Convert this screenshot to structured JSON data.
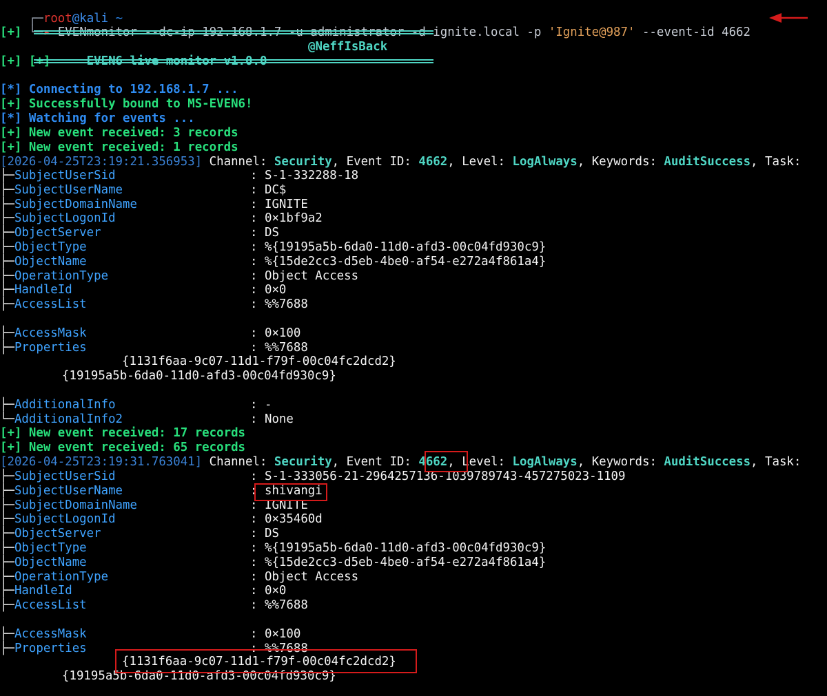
{
  "prompt": {
    "corner": "┌─",
    "user": "root",
    "at": "@",
    "host": "kali",
    "path": "~",
    "arrow": "└─",
    "caret": "▸",
    "cmd_name": "EVENmonitor",
    "cmd_args1": "--dc-ip 192.168.1.7 -u administrator -d ignite.local -p",
    "cmd_password": "'Ignite@987'",
    "cmd_args2": "--event-id 4662"
  },
  "banner": {
    "prefix": "[+]",
    "title": "EVEN6 live monitor v1.0.0",
    "author": "@NeffIsBack"
  },
  "status": [
    {
      "prefix": "[*]",
      "text": "Connecting to 192.168.1.7 ...",
      "kind": "info"
    },
    {
      "prefix": "[+]",
      "text": "Successfully bound to MS-EVEN6!",
      "kind": "ok"
    },
    {
      "prefix": "[*]",
      "text": "Watching for events ...",
      "kind": "info"
    },
    {
      "prefix": "[+]",
      "text": "New event received: 3 records",
      "kind": "ok"
    },
    {
      "prefix": "[+]",
      "text": "New event received: 1 records",
      "kind": "ok"
    }
  ],
  "labels": {
    "channel": "Channel:",
    "event_id": "Event ID:",
    "level": "Level:",
    "keywords": "Keywords:",
    "task": "Task:",
    "sep": ":"
  },
  "event1": {
    "timestamp": "[2026-04-25T23:19:21.356953]",
    "channel": "Security",
    "event_id": "4662",
    "level": "LogAlways",
    "keywords": "AuditSuccess",
    "fields": [
      {
        "key": "SubjectUserSid",
        "value": "S-1-332288-18"
      },
      {
        "key": "SubjectUserName",
        "value": "DC$"
      },
      {
        "key": "SubjectDomainName",
        "value": "IGNITE"
      },
      {
        "key": "SubjectLogonId",
        "value": "0×1bf9a2"
      },
      {
        "key": "ObjectServer",
        "value": "DS"
      },
      {
        "key": "ObjectType",
        "value": "%{19195a5b-6da0-11d0-afd3-00c04fd930c9}"
      },
      {
        "key": "ObjectName",
        "value": "%{15de2cc3-d5eb-4be0-af54-e272a4f861a4}"
      },
      {
        "key": "OperationType",
        "value": "Object Access"
      },
      {
        "key": "HandleId",
        "value": "0×0"
      },
      {
        "key": "AccessList",
        "value": "%%7688"
      },
      {
        "key": "AccessMask",
        "value": "0×100"
      },
      {
        "key": "Properties",
        "value": "%%7688"
      }
    ],
    "prop_line1": "{1131f6aa-9c07-11d1-f79f-00c04fc2dcd2}",
    "prop_line2": "{19195a5b-6da0-11d0-afd3-00c04fd930c9}",
    "additional": [
      {
        "key": "AdditionalInfo",
        "value": "-"
      },
      {
        "key": "AdditionalInfo2",
        "value": "None"
      }
    ]
  },
  "status2": [
    {
      "prefix": "[+]",
      "text": "New event received: 17 records"
    },
    {
      "prefix": "[+]",
      "text": "New event received: 65 records"
    }
  ],
  "event2": {
    "timestamp": "[2026-04-25T23:19:31.763041]",
    "channel": "Security",
    "event_id": "4662",
    "level": "LogAlways",
    "keywords": "AuditSuccess",
    "fields": [
      {
        "key": "SubjectUserSid",
        "value": "S-1-333056-21-2964257136-1039789743-457275023-1109"
      },
      {
        "key": "SubjectUserName",
        "value": "shivangi"
      },
      {
        "key": "SubjectDomainName",
        "value": "IGNITE"
      },
      {
        "key": "SubjectLogonId",
        "value": "0×35460d"
      },
      {
        "key": "ObjectServer",
        "value": "DS"
      },
      {
        "key": "ObjectType",
        "value": "%{19195a5b-6da0-11d0-afd3-00c04fd930c9}"
      },
      {
        "key": "ObjectName",
        "value": "%{15de2cc3-d5eb-4be0-af54-e272a4f861a4}"
      },
      {
        "key": "OperationType",
        "value": "Object Access"
      },
      {
        "key": "HandleId",
        "value": "0×0"
      },
      {
        "key": "AccessList",
        "value": "%%7688"
      },
      {
        "key": "AccessMask",
        "value": "0×100"
      },
      {
        "key": "Properties",
        "value": "%%7688"
      }
    ],
    "prop_line1": "{1131f6aa-9c07-11d1-f79f-00c04fc2dcd2}",
    "prop_line2": "{19195a5b-6da0-11d0-afd3-00c04fd930c9}"
  },
  "colors": {
    "background": "#000000",
    "annotation_red": "#d51b1b",
    "accent_teal": "#4fd6c4",
    "status_green": "#28e07c",
    "info_blue": "#2f8cf2",
    "key_blue": "#3fa3ff"
  },
  "icons": {
    "annotation": "red-arrow-icon"
  }
}
